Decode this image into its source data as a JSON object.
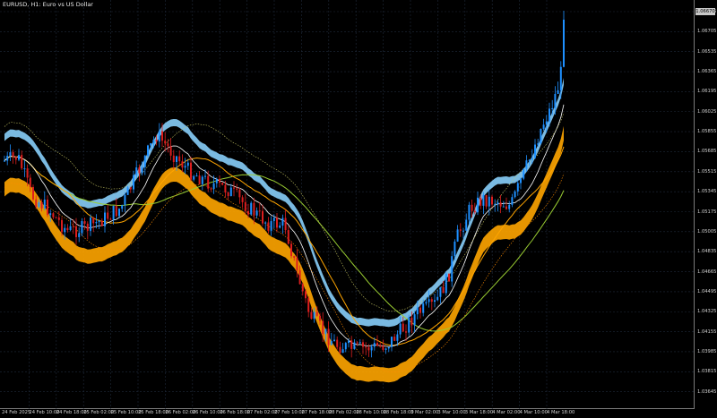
{
  "chart": {
    "title": "EURUSD, H1:  Euro vs US Dollar",
    "current_price": "1.06670",
    "colors": {
      "background": "#000000",
      "grid": "#1f2a3a",
      "bull_candle": "#1e90ff",
      "bear_candle": "#dc1e1e",
      "band_upper_fill": "#87cefa",
      "band_lower_fill": "#ffa500",
      "ma_green": "#9acd32",
      "ma_orange": "#ffa500",
      "ma_white": "#ffffff",
      "channel_upper": "#c8c864",
      "channel_lower": "#ff8c00"
    }
  },
  "price_axis": {
    "ticks": [
      "1.06875",
      "1.06705",
      "1.06535",
      "1.06365",
      "1.06195",
      "1.06025",
      "1.05855",
      "1.05685",
      "1.05515",
      "1.05345",
      "1.05175",
      "1.05005",
      "1.04835",
      "1.04665",
      "1.04495",
      "1.04325",
      "1.04155",
      "1.03985",
      "1.03815",
      "1.03645"
    ]
  },
  "time_axis": {
    "ticks": [
      "24 Feb 2025",
      "24 Feb 10:00",
      "24 Feb 18:00",
      "25 Feb 02:00",
      "25 Feb 10:00",
      "25 Feb 18:00",
      "26 Feb 02:00",
      "26 Feb 10:00",
      "26 Feb 18:00",
      "27 Feb 02:00",
      "27 Feb 10:00",
      "27 Feb 18:00",
      "28 Feb 02:00",
      "28 Feb 10:00",
      "28 Feb 18:00",
      "3 Mar 02:00",
      "3 Mar 10:00",
      "3 Mar 18:00",
      "4 Mar 02:00",
      "4 Mar 10:00",
      "4 Mar 18:00"
    ]
  }
}
